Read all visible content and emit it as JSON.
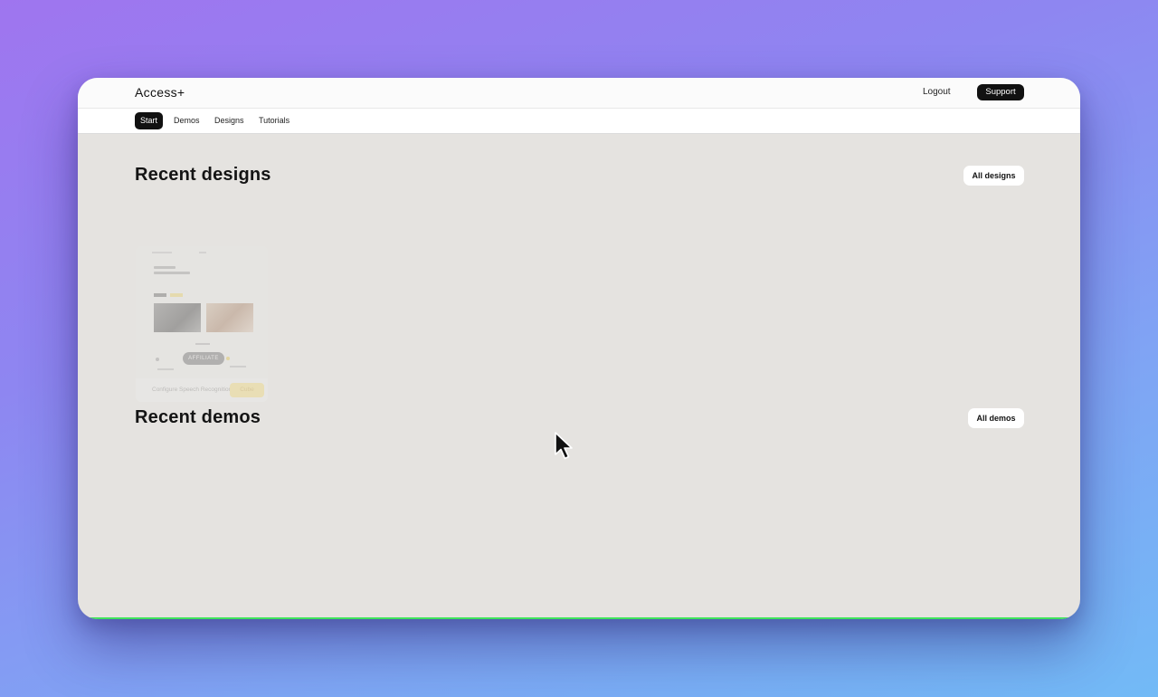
{
  "app": {
    "brand": "Access+"
  },
  "header": {
    "logout_label": "Logout",
    "support_label": "Support"
  },
  "nav": {
    "items": [
      {
        "label": "Start",
        "active": true
      },
      {
        "label": "Demos",
        "active": false
      },
      {
        "label": "Designs",
        "active": false
      },
      {
        "label": "Tutorials",
        "active": false
      }
    ]
  },
  "designs": {
    "title": "Recent designs",
    "all_label": "All designs",
    "card": {
      "badge_label": "AFFILIATE",
      "footer_text": "Configure Speech Recognition",
      "footer_button": "Cube"
    }
  },
  "demos": {
    "title": "Recent demos",
    "all_label": "All demos"
  },
  "colors": {
    "background_gradient_start": "#9f75ef",
    "background_gradient_end": "#72baf6",
    "accent_dark": "#111111",
    "progress": "#3fe35c",
    "content_bg": "#e5e3e0"
  },
  "icons": {
    "cursor": "mouse-pointer-icon"
  }
}
